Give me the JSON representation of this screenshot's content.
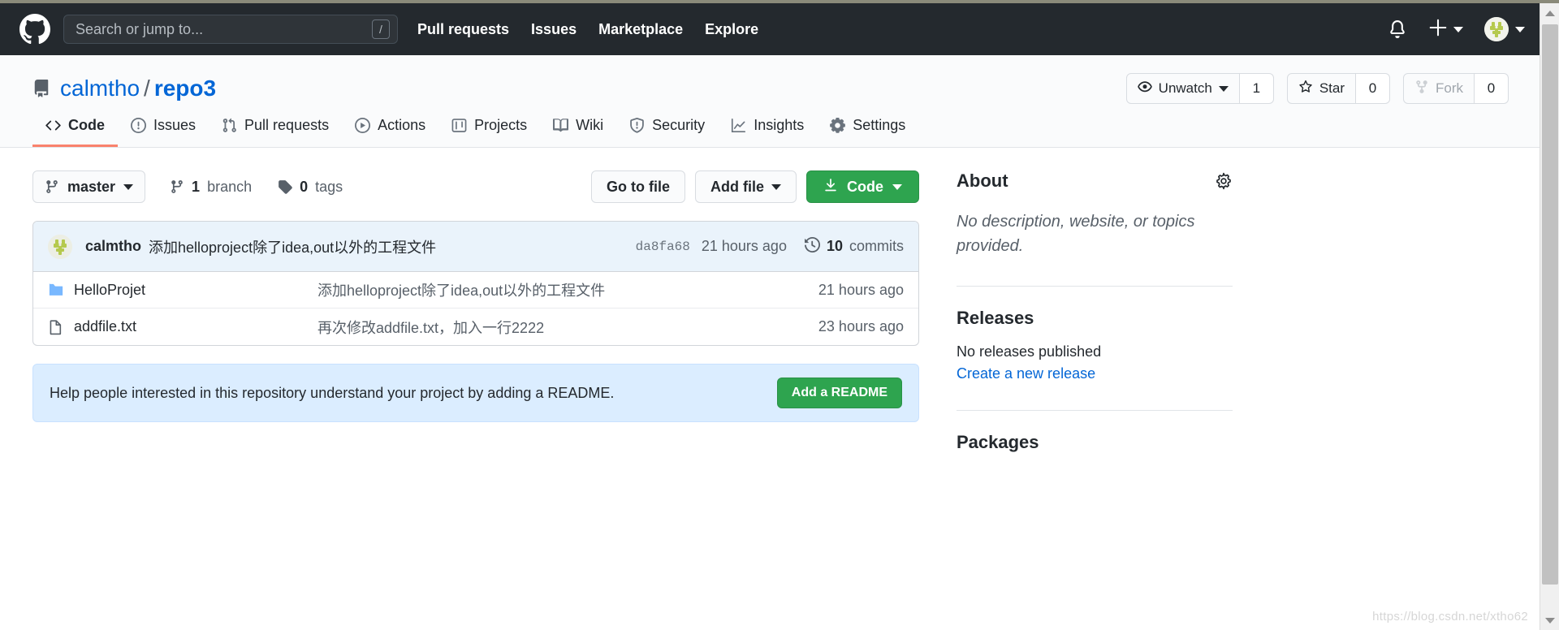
{
  "header": {
    "logo_icon": "github-mark-icon",
    "search": {
      "placeholder": "Search or jump to...",
      "value": "",
      "shortcut": "/"
    },
    "nav": [
      {
        "label": "Pull requests"
      },
      {
        "label": "Issues"
      },
      {
        "label": "Marketplace"
      },
      {
        "label": "Explore"
      }
    ],
    "notifications_icon": "bell-icon",
    "create_new_icon": "plus-icon",
    "create_new_caret": "chevron-down-icon",
    "avatar_icon": "user-avatar",
    "avatar_caret": "chevron-down-icon"
  },
  "repo": {
    "icon": "repo-book-icon",
    "owner": "calmtho",
    "separator": "/",
    "name": "repo3",
    "actions": {
      "watch": {
        "icon": "eye-icon",
        "label": "Unwatch",
        "caret": "chevron-down-icon",
        "count": "1"
      },
      "star": {
        "icon": "star-icon",
        "label": "Star",
        "count": "0"
      },
      "fork": {
        "icon": "fork-icon",
        "label": "Fork",
        "count": "0",
        "disabled": true
      }
    }
  },
  "tabs": [
    {
      "label": "Code",
      "icon": "code-icon",
      "active": true
    },
    {
      "label": "Issues",
      "icon": "issue-opened-icon",
      "active": false
    },
    {
      "label": "Pull requests",
      "icon": "git-pull-request-icon",
      "active": false
    },
    {
      "label": "Actions",
      "icon": "play-icon",
      "active": false
    },
    {
      "label": "Projects",
      "icon": "project-board-icon",
      "active": false
    },
    {
      "label": "Wiki",
      "icon": "book-icon",
      "active": false
    },
    {
      "label": "Security",
      "icon": "shield-icon",
      "active": false
    },
    {
      "label": "Insights",
      "icon": "graph-icon",
      "active": false
    },
    {
      "label": "Settings",
      "icon": "gear-icon",
      "active": false
    }
  ],
  "toolbar": {
    "branch": {
      "icon": "git-branch-icon",
      "label": "master",
      "caret": "chevron-down-icon"
    },
    "branch_count": {
      "icon": "git-branch-icon",
      "count": "1",
      "label": "branch"
    },
    "tag_count": {
      "icon": "tag-icon",
      "count": "0",
      "label": "tags"
    },
    "go_to_file": "Go to file",
    "add_file": "Add file",
    "add_file_caret": "chevron-down-icon",
    "code_button": {
      "icon": "download-icon",
      "label": "Code",
      "caret": "chevron-down-icon"
    }
  },
  "latest_commit": {
    "avatar_icon": "user-avatar",
    "author": "calmtho",
    "message": "添加helloproject除了idea,out以外的工程文件",
    "hash": "da8fa68",
    "time": "21 hours ago",
    "commits_icon": "history-icon",
    "commits_count": "10",
    "commits_label": "commits"
  },
  "files": [
    {
      "icon": "folder-icon",
      "type": "folder",
      "name": "HelloProjet",
      "message": "添加helloproject除了idea,out以外的工程文件",
      "time": "21 hours ago"
    },
    {
      "icon": "file-icon",
      "type": "file",
      "name": "addfile.txt",
      "message": "再次修改addfile.txt，加入一行2222",
      "time": "23 hours ago"
    }
  ],
  "readme_banner": {
    "text": "Help people interested in this repository understand your project by adding a README.",
    "button": "Add a README"
  },
  "sidebar": {
    "about": {
      "title": "About",
      "gear_icon": "gear-icon",
      "description": "No description, website, or topics provided."
    },
    "releases": {
      "title": "Releases",
      "empty_text": "No releases published",
      "create_link": "Create a new release"
    },
    "packages": {
      "title": "Packages"
    }
  },
  "scrollbar": {
    "up_icon": "triangle-up-icon",
    "down_icon": "triangle-down-icon"
  },
  "watermark": "https://blog.csdn.net/xtho62",
  "colors": {
    "header_bg": "#24292e",
    "accent_blue": "#0366d6",
    "green": "#2ea44f",
    "active_tab": "#f9826c",
    "banner_bg": "#dbedff"
  }
}
